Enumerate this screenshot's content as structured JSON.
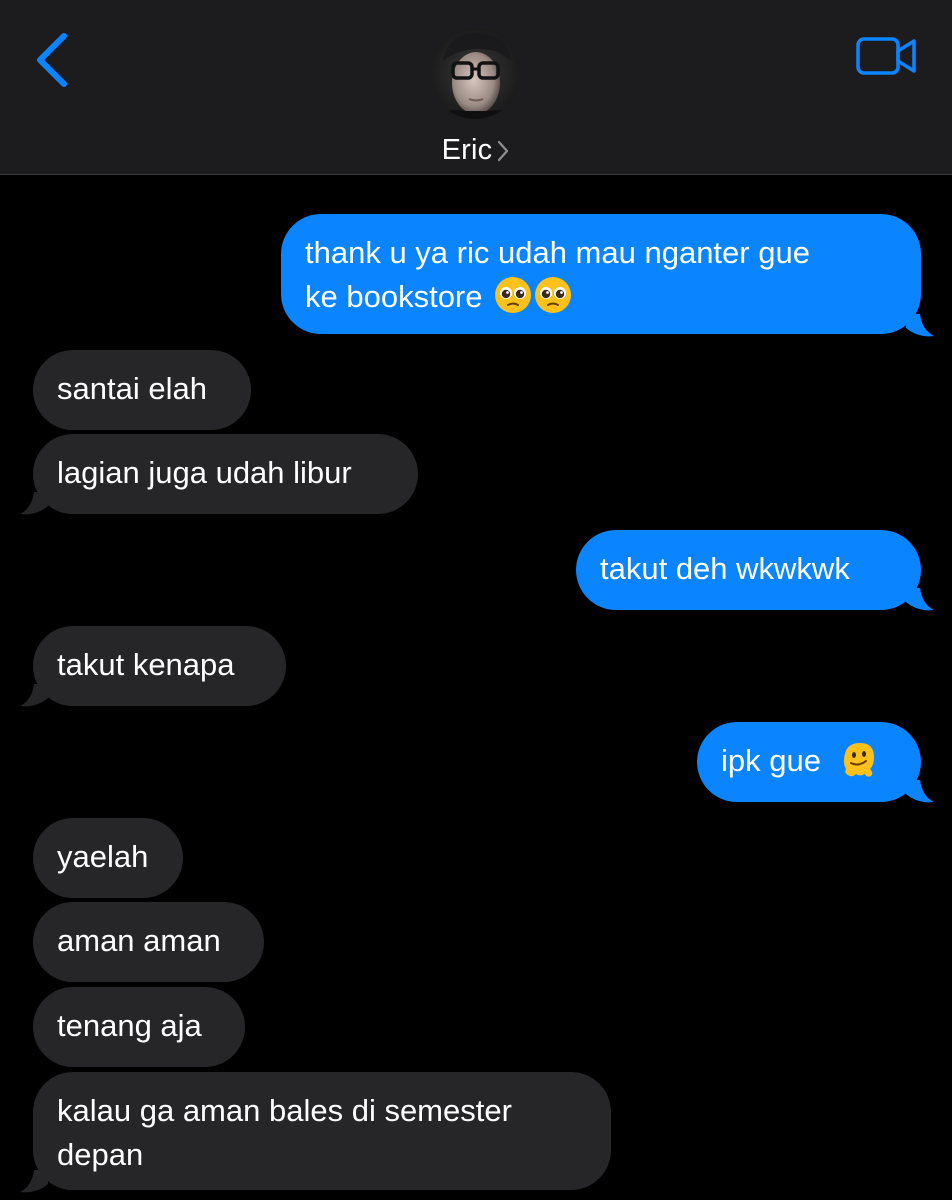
{
  "header": {
    "contact_name": "Eric",
    "back_icon": "chevron-left-icon",
    "video_icon": "video-camera-icon",
    "accent_color": "#0a84ff",
    "background_color": "#1c1c1e"
  },
  "colors": {
    "outgoing_bubble": "#0a84ff",
    "incoming_bubble": "#262629",
    "screen_background": "#000000"
  },
  "messages": [
    {
      "direction": "outgoing",
      "line1": "thank u ya ric udah mau nganter gue",
      "line2": "ke bookstore",
      "emoji": "pleading-face-emoji x2"
    },
    {
      "direction": "incoming",
      "text": "santai elah"
    },
    {
      "direction": "incoming",
      "text": "lagian juga udah libur"
    },
    {
      "direction": "outgoing",
      "text": "takut deh wkwkwk"
    },
    {
      "direction": "incoming",
      "text": "takut kenapa"
    },
    {
      "direction": "outgoing",
      "text": "ipk gue",
      "emoji": "melting-face-emoji"
    },
    {
      "direction": "incoming",
      "text": "yaelah"
    },
    {
      "direction": "incoming",
      "text": "aman aman"
    },
    {
      "direction": "incoming",
      "text": "tenang aja"
    },
    {
      "direction": "incoming",
      "line1": "kalau ga aman bales di semester",
      "line2": "depan"
    }
  ]
}
